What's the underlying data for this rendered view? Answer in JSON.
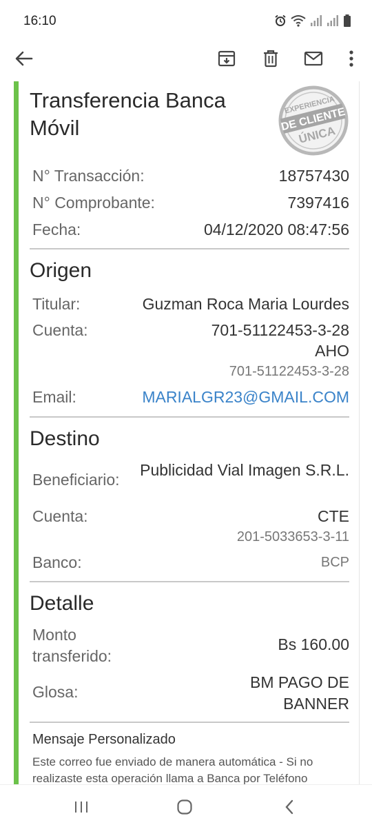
{
  "status": {
    "time": "16:10"
  },
  "icons": {
    "back": "arrow-left-icon",
    "archive": "archive-icon",
    "delete": "trash-icon",
    "mail": "mail-icon",
    "more": "more-vert-icon"
  },
  "email": {
    "title": "Transferencia Banca Móvil",
    "stamp": {
      "top": "EXPERIENCIA",
      "middle": "DE CLIENTE",
      "bottom": "ÚNICA"
    },
    "transaction": {
      "transaccion_label": "N° Transacción:",
      "transaccion_value": "18757430",
      "comprobante_label": "N° Comprobante:",
      "comprobante_value": "7397416",
      "fecha_label": "Fecha:",
      "fecha_value": "04/12/2020 08:47:56"
    },
    "origen": {
      "heading": "Origen",
      "titular_label": "Titular:",
      "titular_value": "Guzman Roca Maria Lourdes",
      "cuenta_label": "Cuenta:",
      "cuenta_line1": "701-51122453-3-28",
      "cuenta_line2": "AHO",
      "cuenta_sub": "701-51122453-3-28",
      "email_label": "Email:",
      "email_value": "MARIALGR23@GMAIL.COM"
    },
    "destino": {
      "heading": "Destino",
      "beneficiario_label": "Beneficiario:",
      "beneficiario_value": "Publicidad Vial Imagen S.R.L.",
      "cuenta_label": "Cuenta:",
      "cuenta_type": "CTE",
      "cuenta_sub": "201-5033653-3-11",
      "banco_label": "Banco:",
      "banco_value": "BCP"
    },
    "detalle": {
      "heading": "Detalle",
      "monto_label": "Monto transferido:",
      "monto_value": "Bs 160.00",
      "glosa_label": "Glosa:",
      "glosa_value": "BM PAGO DE BANNER"
    },
    "mensaje": {
      "title": "Mensaje Personalizado",
      "text": "Este correo fue enviado de manera automática - Si no realizaste esta operación llama a Banca por Teléfono"
    }
  },
  "colors": {
    "accent_bar": "#6cc24a",
    "link": "#3a83c9",
    "divider": "#c8c8c8"
  }
}
